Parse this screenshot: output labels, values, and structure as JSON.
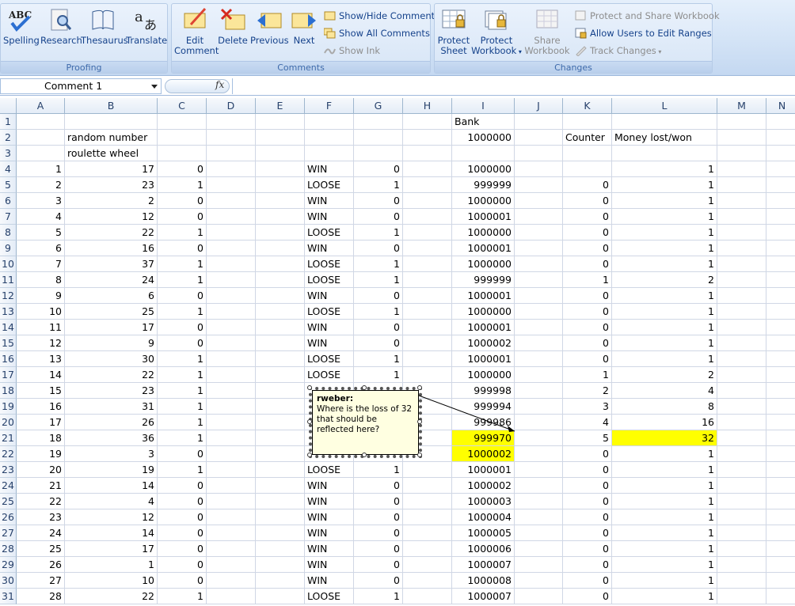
{
  "ribbon": {
    "proofing": {
      "label": "Proofing",
      "buttons": [
        "Spelling",
        "Research",
        "Thesaurus",
        "Translate"
      ]
    },
    "comments": {
      "label": "Comments",
      "edit_line1": "Edit",
      "edit_line2": "Comment",
      "delete": "Delete",
      "previous": "Previous",
      "next": "Next",
      "show_hide": "Show/Hide Comment",
      "show_all": "Show All Comments",
      "show_ink": "Show Ink"
    },
    "changes": {
      "label": "Changes",
      "protect_sheet_1": "Protect",
      "protect_sheet_2": "Sheet",
      "protect_workbook_1": "Protect",
      "protect_workbook_2": "Workbook",
      "share_workbook_1": "Share",
      "share_workbook_2": "Workbook",
      "protect_share": "Protect and Share Workbook",
      "allow_users": "Allow Users to Edit Ranges",
      "track_changes": "Track Changes"
    }
  },
  "formula_bar": {
    "name_box": "Comment 1",
    "fx": "fx",
    "formula": ""
  },
  "columns": [
    "A",
    "B",
    "C",
    "D",
    "E",
    "F",
    "G",
    "H",
    "I",
    "J",
    "K",
    "L",
    "M",
    "N"
  ],
  "header_cells": {
    "r1_I": "Bank",
    "r2_B": "random number",
    "r2_I": "1000000",
    "r2_K": "Counter",
    "r2_L": "Money lost/won",
    "r3_B": "roulette wheel"
  },
  "rows": [
    {
      "r": "4",
      "A": "1",
      "B": "17",
      "C": "0",
      "F": "WIN",
      "G": "0",
      "I": "1000000",
      "K": "",
      "L": "1"
    },
    {
      "r": "5",
      "A": "2",
      "B": "23",
      "C": "1",
      "F": "LOOSE",
      "G": "1",
      "I": "999999",
      "K": "0",
      "L": "1"
    },
    {
      "r": "6",
      "A": "3",
      "B": "2",
      "C": "0",
      "F": "WIN",
      "G": "0",
      "I": "1000000",
      "K": "0",
      "L": "1"
    },
    {
      "r": "7",
      "A": "4",
      "B": "12",
      "C": "0",
      "F": "WIN",
      "G": "0",
      "I": "1000001",
      "K": "0",
      "L": "1"
    },
    {
      "r": "8",
      "A": "5",
      "B": "22",
      "C": "1",
      "F": "LOOSE",
      "G": "1",
      "I": "1000000",
      "K": "0",
      "L": "1"
    },
    {
      "r": "9",
      "A": "6",
      "B": "16",
      "C": "0",
      "F": "WIN",
      "G": "0",
      "I": "1000001",
      "K": "0",
      "L": "1"
    },
    {
      "r": "10",
      "A": "7",
      "B": "37",
      "C": "1",
      "F": "LOOSE",
      "G": "1",
      "I": "1000000",
      "K": "0",
      "L": "1"
    },
    {
      "r": "11",
      "A": "8",
      "B": "24",
      "C": "1",
      "F": "LOOSE",
      "G": "1",
      "I": "999999",
      "K": "1",
      "L": "2"
    },
    {
      "r": "12",
      "A": "9",
      "B": "6",
      "C": "0",
      "F": "WIN",
      "G": "0",
      "I": "1000001",
      "K": "0",
      "L": "1"
    },
    {
      "r": "13",
      "A": "10",
      "B": "25",
      "C": "1",
      "F": "LOOSE",
      "G": "1",
      "I": "1000000",
      "K": "0",
      "L": "1"
    },
    {
      "r": "14",
      "A": "11",
      "B": "17",
      "C": "0",
      "F": "WIN",
      "G": "0",
      "I": "1000001",
      "K": "0",
      "L": "1"
    },
    {
      "r": "15",
      "A": "12",
      "B": "9",
      "C": "0",
      "F": "WIN",
      "G": "0",
      "I": "1000002",
      "K": "0",
      "L": "1"
    },
    {
      "r": "16",
      "A": "13",
      "B": "30",
      "C": "1",
      "F": "LOOSE",
      "G": "1",
      "I": "1000001",
      "K": "0",
      "L": "1"
    },
    {
      "r": "17",
      "A": "14",
      "B": "22",
      "C": "1",
      "F": "LOOSE",
      "G": "1",
      "I": "1000000",
      "K": "1",
      "L": "2"
    },
    {
      "r": "18",
      "A": "15",
      "B": "23",
      "C": "1",
      "F": "",
      "G": "",
      "I": "999998",
      "K": "2",
      "L": "4"
    },
    {
      "r": "19",
      "A": "16",
      "B": "31",
      "C": "1",
      "F": "",
      "G": "",
      "I": "999994",
      "K": "3",
      "L": "8"
    },
    {
      "r": "20",
      "A": "17",
      "B": "26",
      "C": "1",
      "F": "",
      "G": "",
      "I": "999986",
      "K": "4",
      "L": "16"
    },
    {
      "r": "21",
      "A": "18",
      "B": "36",
      "C": "1",
      "F": "",
      "G": "",
      "I": "999970",
      "K": "5",
      "L": "32",
      "hlI": true,
      "hlL": true
    },
    {
      "r": "22",
      "A": "19",
      "B": "3",
      "C": "0",
      "F": "",
      "G": "",
      "I": "1000002",
      "K": "0",
      "L": "1",
      "hlI": true
    },
    {
      "r": "23",
      "A": "20",
      "B": "19",
      "C": "1",
      "F": "LOOSE",
      "G": "1",
      "I": "1000001",
      "K": "0",
      "L": "1"
    },
    {
      "r": "24",
      "A": "21",
      "B": "14",
      "C": "0",
      "F": "WIN",
      "G": "0",
      "I": "1000002",
      "K": "0",
      "L": "1"
    },
    {
      "r": "25",
      "A": "22",
      "B": "4",
      "C": "0",
      "F": "WIN",
      "G": "0",
      "I": "1000003",
      "K": "0",
      "L": "1"
    },
    {
      "r": "26",
      "A": "23",
      "B": "12",
      "C": "0",
      "F": "WIN",
      "G": "0",
      "I": "1000004",
      "K": "0",
      "L": "1"
    },
    {
      "r": "27",
      "A": "24",
      "B": "14",
      "C": "0",
      "F": "WIN",
      "G": "0",
      "I": "1000005",
      "K": "0",
      "L": "1"
    },
    {
      "r": "28",
      "A": "25",
      "B": "17",
      "C": "0",
      "F": "WIN",
      "G": "0",
      "I": "1000006",
      "K": "0",
      "L": "1"
    },
    {
      "r": "29",
      "A": "26",
      "B": "1",
      "C": "0",
      "F": "WIN",
      "G": "0",
      "I": "1000007",
      "K": "0",
      "L": "1"
    },
    {
      "r": "30",
      "A": "27",
      "B": "10",
      "C": "0",
      "F": "WIN",
      "G": "0",
      "I": "1000008",
      "K": "0",
      "L": "1"
    },
    {
      "r": "31",
      "A": "28",
      "B": "22",
      "C": "1",
      "F": "LOOSE",
      "G": "1",
      "I": "1000007",
      "K": "0",
      "L": "1"
    }
  ],
  "comment": {
    "author": "rweber:",
    "text": "Where is the loss of 32 that should be reflected here?"
  },
  "colors": {
    "highlight": "#ffff00",
    "comment_bg": "#ffffe1",
    "ribbon_text": "#15428b"
  }
}
